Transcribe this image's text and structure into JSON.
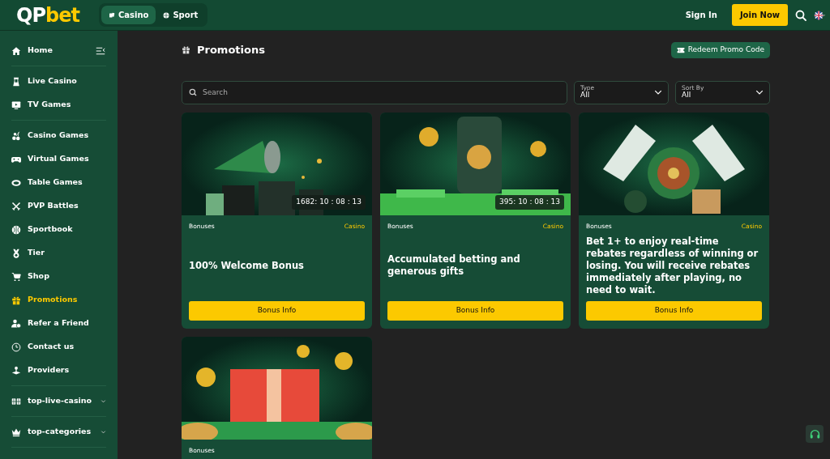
{
  "header": {
    "logo": [
      "QP",
      "bet"
    ],
    "tabs": [
      {
        "label": "Casino",
        "selected": true
      },
      {
        "label": "Sport",
        "selected": false
      }
    ],
    "sign_in": "Sign In",
    "join": "Join Now"
  },
  "sidebar": {
    "sections": [
      [
        {
          "label": "Home",
          "kind": "link",
          "selected": false
        }
      ],
      [
        {
          "label": "Live Casino",
          "kind": "link",
          "selected": false
        },
        {
          "label": "TV Games",
          "kind": "link",
          "selected": false
        }
      ],
      [
        {
          "label": "Casino Games",
          "kind": "link",
          "selected": false
        },
        {
          "label": "Virtual Games",
          "kind": "link",
          "selected": false
        },
        {
          "label": "Table Games",
          "kind": "link",
          "selected": false
        },
        {
          "label": "PVP Battles",
          "kind": "link",
          "selected": false
        },
        {
          "label": "Sportbook",
          "kind": "link",
          "selected": false
        },
        {
          "label": "Tier",
          "kind": "link",
          "selected": false
        },
        {
          "label": "Shop",
          "kind": "link",
          "selected": false
        },
        {
          "label": "Promotions",
          "kind": "link",
          "selected": true
        },
        {
          "label": "Refer a Friend",
          "kind": "link",
          "selected": false
        },
        {
          "label": "Contact us",
          "kind": "link",
          "selected": false
        },
        {
          "label": "Providers",
          "kind": "link",
          "selected": false
        }
      ],
      [
        {
          "label": "top-live-casino",
          "kind": "dropdown",
          "selected": false
        }
      ],
      [
        {
          "label": "top-categories",
          "kind": "dropdown",
          "selected": false
        }
      ]
    ]
  },
  "page": {
    "title": "Promotions",
    "redeem": "Redeem Promo Code"
  },
  "filters": {
    "search": {
      "placeholder": "Search"
    },
    "selects": [
      {
        "label": "Type",
        "value": "All"
      },
      {
        "label": "Sort By",
        "value": "All"
      }
    ]
  },
  "cards": [
    {
      "timer": "1682: 10 : 08 : 13",
      "tag": "Bonuses",
      "category": "Casino",
      "title": "100% Welcome Bonus",
      "button": "Bonus Info"
    },
    {
      "timer": "395: 10 : 08 : 13",
      "tag": "Bonuses",
      "category": "Casino",
      "title": "Accumulated betting and generous gifts",
      "button": "Bonus Info"
    },
    {
      "tag": "Bonuses",
      "category": "Casino",
      "title": "Bet 1+ to enjoy real-time rebates regardless of winning or losing. You will receive rebates immediately after playing, no need to wait.",
      "button": "Bonus Info"
    },
    {
      "tag": "Bonuses"
    }
  ]
}
